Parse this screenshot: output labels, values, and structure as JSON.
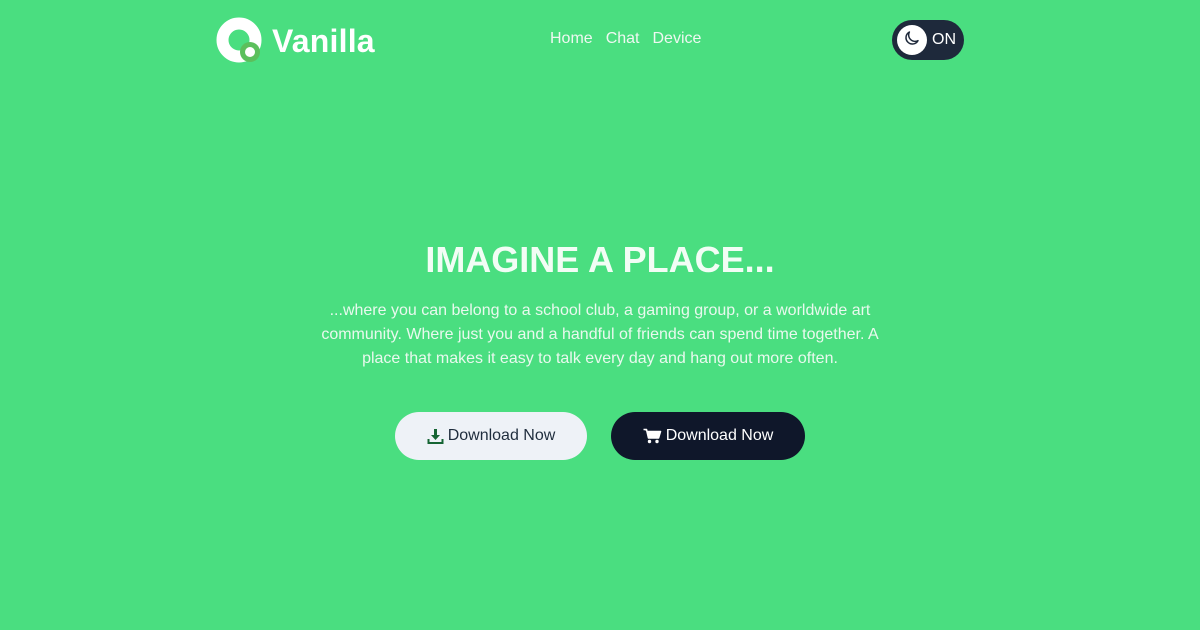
{
  "brand": {
    "name": "Vanilla",
    "logo_icon": "vanilla-logo-icon"
  },
  "nav": {
    "items": [
      {
        "label": "Home"
      },
      {
        "label": "Chat"
      },
      {
        "label": "Device"
      }
    ]
  },
  "theme_toggle": {
    "icon": "moon-icon",
    "label": "ON"
  },
  "hero": {
    "title": "IMAGINE A PLACE...",
    "text": "...where you can belong to a school club, a gaming group, or a worldwide art community. Where just you and a handful of friends can spend time together. A place that makes it easy to talk every day and hang out more often."
  },
  "buttons": {
    "download": {
      "label": "Download Now",
      "icon": "download-icon"
    },
    "buy": {
      "label": "Download Now",
      "icon": "cart-icon"
    }
  },
  "colors": {
    "background": "#4ade80",
    "button_light": "#eef2f7",
    "button_dark": "#0f172a",
    "toggle_bg": "#1e293b",
    "logo_accent": "#5cbf5c"
  }
}
